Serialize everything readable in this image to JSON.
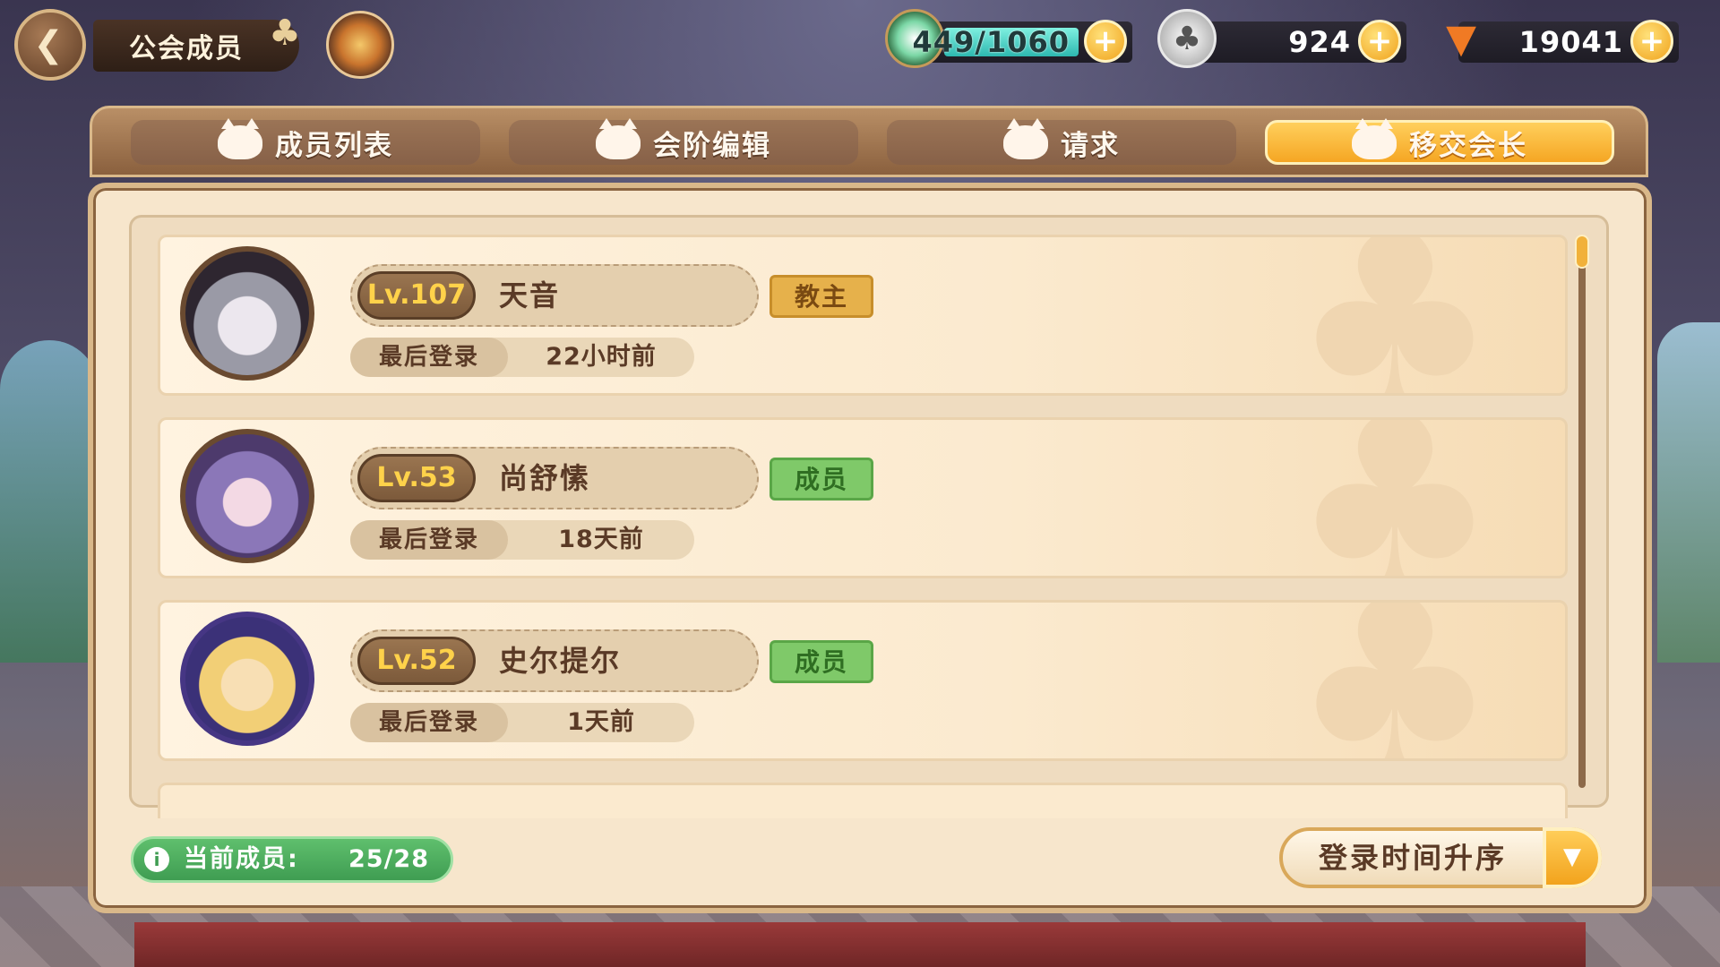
{
  "header": {
    "back_icon": "back-arrow-icon",
    "title": "公会成员",
    "resources": {
      "stamina": "449/1060",
      "clover": "924",
      "carrot": "19041"
    }
  },
  "tabs": [
    {
      "label": "成员列表",
      "active": false
    },
    {
      "label": "会阶编辑",
      "active": false
    },
    {
      "label": "请求",
      "active": false
    },
    {
      "label": "移交会长",
      "active": true
    }
  ],
  "members": [
    {
      "level": "Lv.107",
      "name": "天音",
      "role": "教主",
      "login_label": "最后登录",
      "login_value": "22小时前"
    },
    {
      "level": "Lv.53",
      "name": "尚舒愫",
      "role": "成员",
      "login_label": "最后登录",
      "login_value": "18天前"
    },
    {
      "level": "Lv.52",
      "name": "史尔提尔",
      "role": "成员",
      "login_label": "最后登录",
      "login_value": "1天前"
    }
  ],
  "footer": {
    "count_label": "当前成员:",
    "count_value": "25/28",
    "sort_label": "登录时间升序"
  },
  "colors": {
    "accent": "#f5a623",
    "leader_badge": "#e6b14b",
    "member_badge": "#7fc969",
    "count_pill": "#4fae5f"
  }
}
